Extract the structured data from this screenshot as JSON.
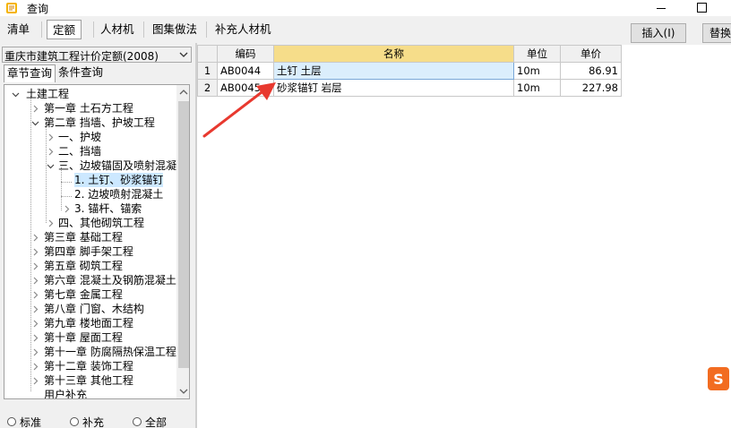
{
  "window": {
    "title": "查询"
  },
  "tabs": [
    {
      "label": "清单"
    },
    {
      "label": "定额"
    },
    {
      "label": "人材机"
    },
    {
      "label": "图集做法"
    },
    {
      "label": "补充人材机"
    }
  ],
  "buttons": {
    "insert": "插入(I)",
    "replace": "替换"
  },
  "quota_selector": {
    "value": "重庆市建筑工程计价定额(2008)"
  },
  "subtabs": [
    {
      "label": "章节查询"
    },
    {
      "label": "条件查询"
    }
  ],
  "tree": [
    {
      "label": "土建工程"
    },
    {
      "label": "第一章 土石方工程"
    },
    {
      "label": "第二章 挡墙、护坡工程"
    },
    {
      "label": "一、护坡"
    },
    {
      "label": "二、挡墙"
    },
    {
      "label": "三、边坡锚固及喷射混凝"
    },
    {
      "label": "1. 土钉、砂浆锚钉"
    },
    {
      "label": "2. 边坡喷射混凝土"
    },
    {
      "label": "3. 锚杆、锚索"
    },
    {
      "label": "四、其他砌筑工程"
    },
    {
      "label": "第三章 基础工程"
    },
    {
      "label": "第四章 脚手架工程"
    },
    {
      "label": "第五章 砌筑工程"
    },
    {
      "label": "第六章 混凝土及钢筋混凝土"
    },
    {
      "label": "第七章 金属工程"
    },
    {
      "label": "第八章 门窗、木结构"
    },
    {
      "label": "第九章 楼地面工程"
    },
    {
      "label": "第十章 屋面工程"
    },
    {
      "label": "第十一章 防腐隔热保温工程"
    },
    {
      "label": "第十二章 装饰工程"
    },
    {
      "label": "第十三章 其他工程"
    },
    {
      "label": "用户补充"
    }
  ],
  "radios": [
    {
      "label": "标准"
    },
    {
      "label": "补充"
    },
    {
      "label": "全部"
    }
  ],
  "grid": {
    "columns": [
      "编码",
      "名称",
      "单位",
      "单价"
    ],
    "rows": [
      {
        "index": "1",
        "code": "AB0044",
        "name": "土钉 土层",
        "unit": "10m",
        "price": "86.91"
      },
      {
        "index": "2",
        "code": "AB0045",
        "name": "砂浆锚钉 岩层",
        "unit": "10m",
        "price": "227.98"
      }
    ]
  },
  "colors": {
    "selection": "#cce8ff",
    "header_highlight": "#f6dd8a",
    "arrow": "#e8392f",
    "sogou": "#f26c21"
  },
  "icons": {
    "app": "app-icon",
    "sogou": "sogou-ime-icon"
  }
}
